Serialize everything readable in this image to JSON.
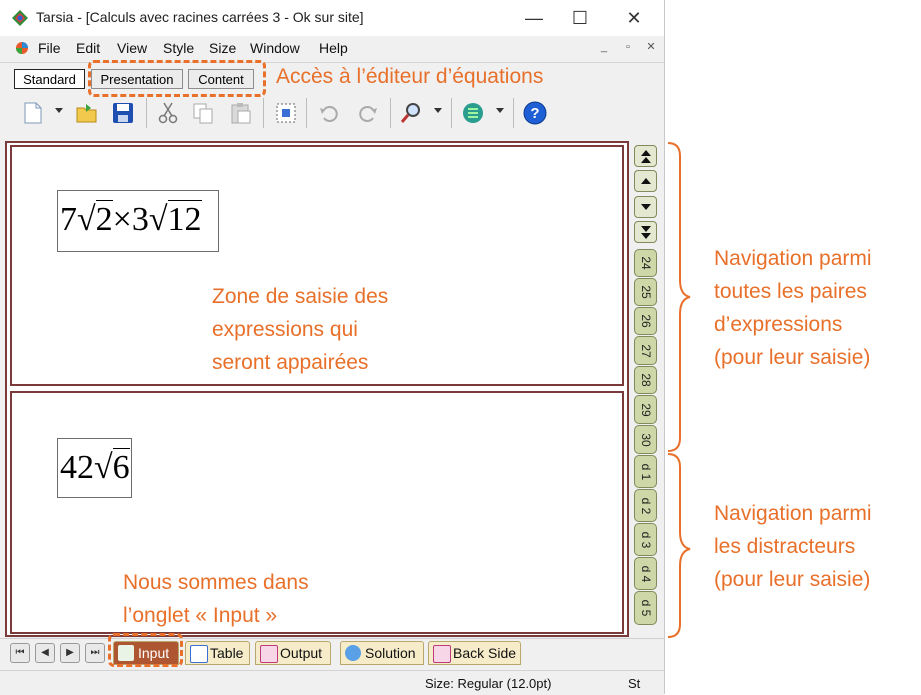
{
  "window": {
    "app_name": "Tarsia",
    "title": "Tarsia - [Calculs avec racines carrées 3 - Ok sur site]",
    "minimize": "—",
    "maximize": "☐",
    "close": "✕"
  },
  "menu": [
    "File",
    "Edit",
    "View",
    "Style",
    "Size",
    "Window",
    "Help"
  ],
  "mdi_buttons": [
    "_",
    "▫",
    "✕"
  ],
  "editor_tabs": [
    "Standard",
    "Presentation",
    "Content"
  ],
  "toolbar_icons": [
    "new-document-icon",
    "open-folder-icon",
    "save-icon",
    "cut-icon",
    "copy-icon",
    "paste-icon",
    "select-all-icon",
    "undo-icon",
    "redo-icon",
    "zoom-icon",
    "network-icon",
    "help-icon"
  ],
  "panes": {
    "top_expression": {
      "coef1": "7",
      "rad1": "2",
      "op": "×",
      "coef2": "3",
      "rad2": "12"
    },
    "bottom_expression": {
      "coef": "42",
      "rad": "6"
    }
  },
  "side_nav": {
    "pair_tabs": [
      "24",
      "25",
      "26",
      "27",
      "28",
      "29",
      "30"
    ],
    "distractor_tabs": [
      "d 1",
      "d 2",
      "d 3",
      "d 4",
      "d 5"
    ]
  },
  "bottom_tabs": [
    "Input",
    "Table",
    "Output",
    "Solution",
    "Back Side"
  ],
  "bottom_nav": [
    "⏮",
    "◀",
    "▶",
    "⏭"
  ],
  "status": {
    "size": "Size: Regular (12.0pt)",
    "right": "St"
  },
  "annotations": {
    "editor": "Accès à l’éditeur d’équations",
    "input_zone": [
      "Zone de saisie des",
      "expressions qui",
      "seront appairées"
    ],
    "nav_pairs": [
      "Navigation parmi",
      "toutes les paires",
      "d’expressions",
      "(pour leur saisie)"
    ],
    "nav_distractors": [
      "Navigation parmi",
      "les distracteurs",
      "(pour leur saisie)"
    ],
    "input_tab": [
      "Nous sommes dans",
      "l’onglet « Input »"
    ]
  },
  "colors": {
    "accent": "#e8702a",
    "frame": "#7a3a3a",
    "tab_green": "#cdd7a8",
    "tab_yellow": "#f6ecc9"
  }
}
